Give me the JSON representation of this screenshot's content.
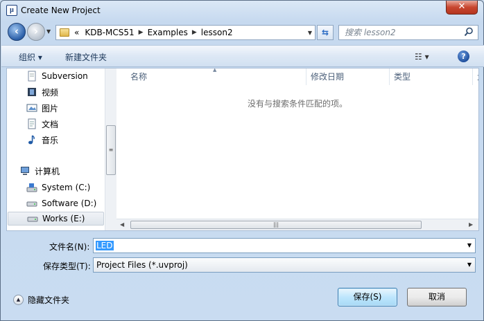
{
  "window": {
    "title": "Create New Project",
    "close_label": "✕"
  },
  "nav": {
    "breadcrumb_prefix": "«",
    "breadcrumbs": [
      "KDB-MCS51",
      "Examples",
      "lesson2"
    ],
    "search_placeholder": "搜索 lesson2"
  },
  "toolbar": {
    "organize_label": "组织 ▾",
    "new_folder_label": "新建文件夹",
    "views_label": "☷ ▾",
    "help_label": "?"
  },
  "sidebar": {
    "items": [
      {
        "label": "Subversion",
        "icon": "subversion-icon"
      },
      {
        "label": "视频",
        "icon": "video-icon"
      },
      {
        "label": "图片",
        "icon": "picture-icon"
      },
      {
        "label": "文档",
        "icon": "document-icon"
      },
      {
        "label": "音乐",
        "icon": "music-icon"
      },
      {
        "label": "计算机",
        "icon": "computer-icon"
      },
      {
        "label": "System (C:)",
        "icon": "drive-icon"
      },
      {
        "label": "Software (D:)",
        "icon": "drive-icon"
      },
      {
        "label": "Works (E:)",
        "icon": "drive-icon",
        "selected": true
      }
    ]
  },
  "file_list": {
    "columns": [
      "名称",
      "修改日期",
      "类型",
      "大"
    ],
    "empty_message": "没有与搜索条件匹配的项。"
  },
  "form": {
    "filename_label": "文件名(N):",
    "filename_value": "LED",
    "filetype_label": "保存类型(T):",
    "filetype_value": "Project Files (*.uvproj)"
  },
  "footer": {
    "hide_folders_label": "隐藏文件夹",
    "save_label": "保存(S)",
    "cancel_label": "取消"
  },
  "colors": {
    "selection": "#3399ff",
    "window_frame": "#c9dcf1",
    "close_button": "#c8462f"
  }
}
